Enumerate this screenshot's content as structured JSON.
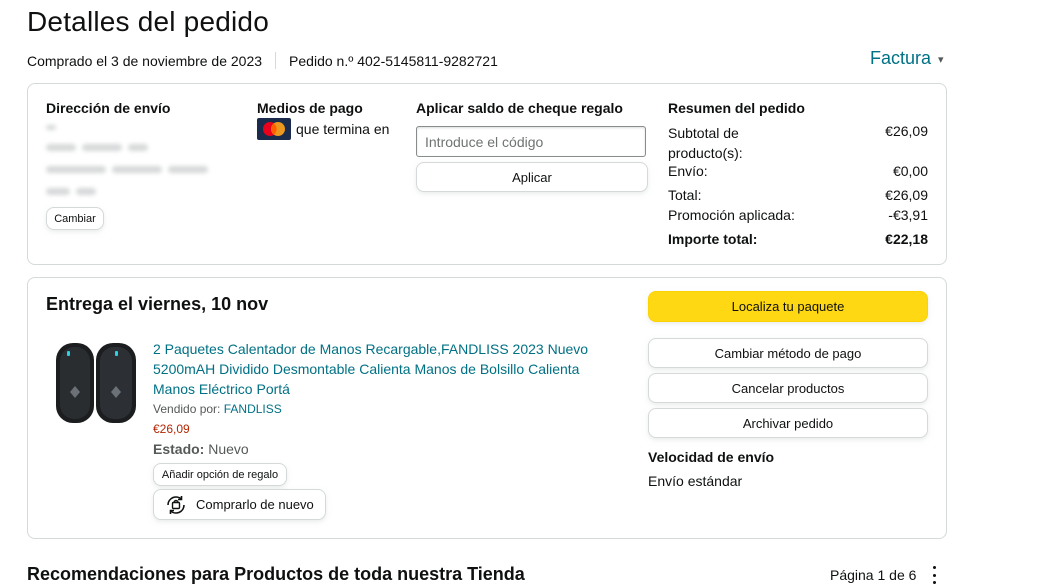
{
  "header": {
    "title": "Detalles del pedido",
    "purchased": "Comprado el 3 de noviembre de 2023",
    "order_number": "Pedido n.º 402-5145811-9282721",
    "invoice_label": "Factura"
  },
  "shipping": {
    "heading": "Dirección de envío",
    "change_label": "Cambiar"
  },
  "payment": {
    "heading": "Medios de pago",
    "card_text": "que termina en",
    "card_icon": "mastercard-icon"
  },
  "gift": {
    "heading": "Aplicar saldo de cheque regalo",
    "placeholder": "Introduce el código",
    "apply_label": "Aplicar"
  },
  "summary": {
    "heading": "Resumen del pedido",
    "rows": [
      {
        "label": "Subtotal de producto(s):",
        "value": "€26,09"
      },
      {
        "label": "Envío:",
        "value": "€0,00"
      },
      {
        "label": "Total:",
        "value": "€26,09"
      },
      {
        "label": "Promoción aplicada:",
        "value": "-€3,91"
      },
      {
        "label": "Importe total:",
        "value": "€22,18"
      }
    ]
  },
  "delivery": {
    "heading": "Entrega el viernes, 10 nov",
    "product": {
      "title": "2 Paquetes Calentador de Manos Recargable,FANDLISS 2023 Nuevo 5200mAH Dividido Desmontable Calienta Manos de Bolsillo Calienta Manos Eléctrico Portá",
      "sold_by_label": "Vendido por:",
      "seller": "FANDLISS",
      "price": "€26,09",
      "status_label": "Estado:",
      "status_value": "Nuevo",
      "gift_option_label": "Añadir opción de regalo",
      "buy_again_label": "Comprarlo de nuevo"
    },
    "actions": {
      "track": "Localiza tu paquete",
      "change_payment": "Cambiar método de pago",
      "cancel": "Cancelar productos",
      "archive": "Archivar pedido"
    },
    "shipping_speed_heading": "Velocidad de envío",
    "shipping_speed_value": "Envío estándar"
  },
  "recommendations": {
    "title": "Recomendaciones para Productos de toda nuestra Tienda",
    "page": "Página 1 de 6"
  },
  "colors": {
    "accent_link": "#007185",
    "price": "#b12704",
    "primary_button": "#ffd814",
    "border": "#d5d9d9"
  }
}
